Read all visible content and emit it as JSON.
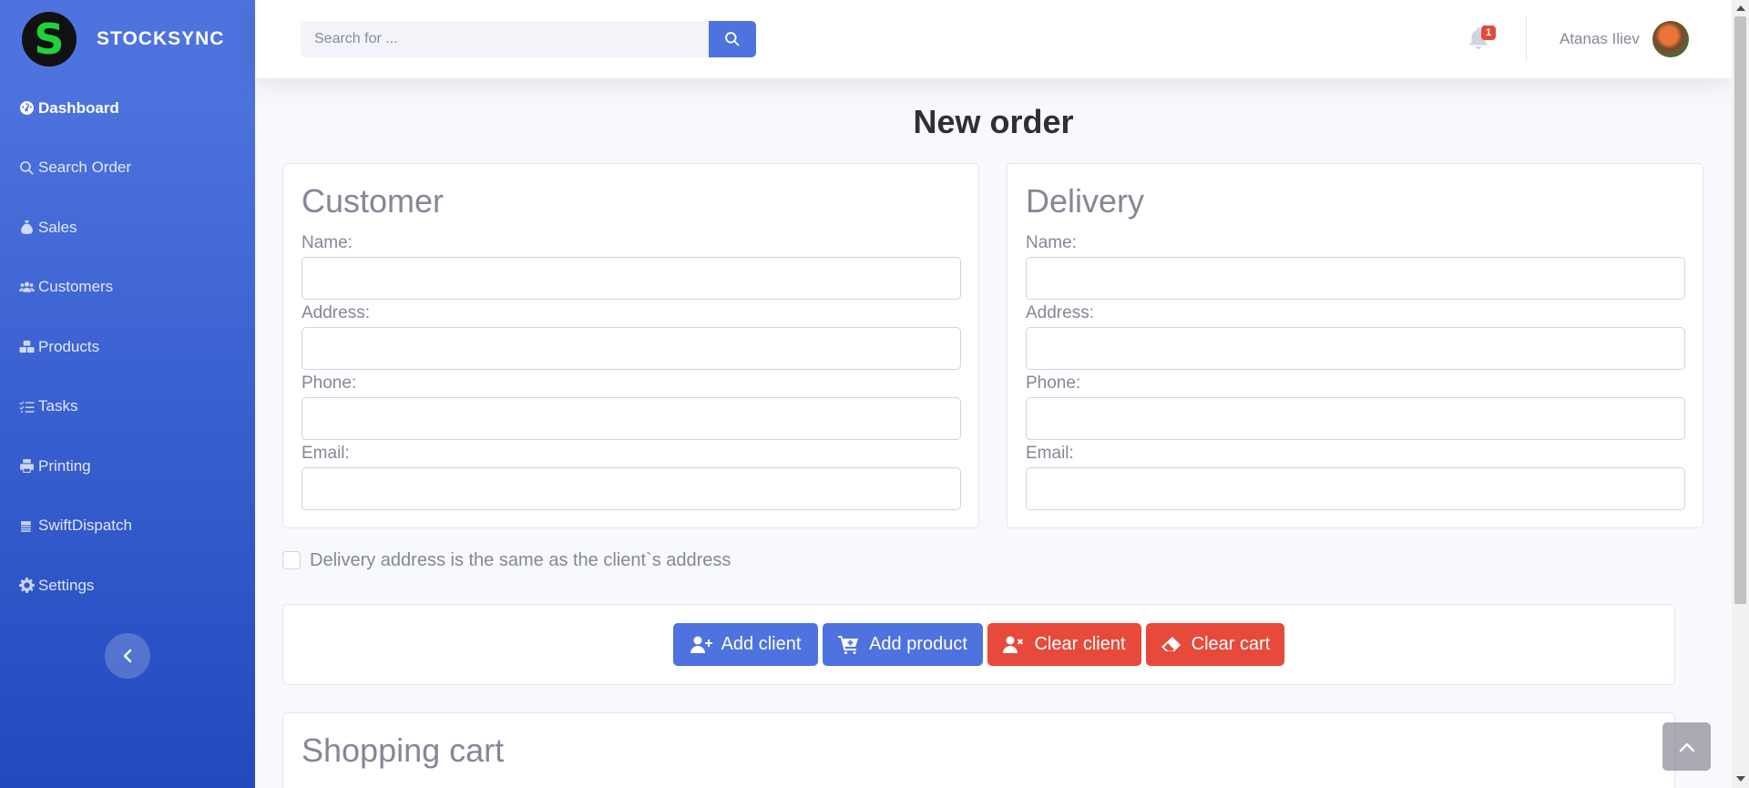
{
  "brand": {
    "logo_letter": "S",
    "name": "STOCKSYNC",
    "logo_color": "#1fd13b"
  },
  "sidebar": {
    "items": [
      {
        "label": "Dashboard",
        "icon": "dashboard-icon",
        "active": true
      },
      {
        "label": "Search Order",
        "icon": "search-icon"
      },
      {
        "label": "Sales",
        "icon": "money-bag-icon"
      },
      {
        "label": "Customers",
        "icon": "users-icon"
      },
      {
        "label": "Products",
        "icon": "boxes-icon"
      },
      {
        "label": "Tasks",
        "icon": "list-check-icon"
      },
      {
        "label": "Printing",
        "icon": "printer-icon"
      },
      {
        "label": "SwiftDispatch",
        "icon": "truck-icon"
      },
      {
        "label": "Settings",
        "icon": "gear-icon"
      }
    ],
    "toggle_icon": "chevron-left-icon"
  },
  "topbar": {
    "search_placeholder": "Search for ...",
    "notification_count": "1",
    "user_name": "Atanas Iliev"
  },
  "page": {
    "title": "New order"
  },
  "customer": {
    "heading": "Customer",
    "name_label": "Name:",
    "address_label": "Address:",
    "phone_label": "Phone:",
    "email_label": "Email:"
  },
  "delivery": {
    "heading": "Delivery",
    "name_label": "Name:",
    "address_label": "Address:",
    "phone_label": "Phone:",
    "email_label": "Email:"
  },
  "same_address_label": "Delivery address is the same as the client`s address",
  "actions": {
    "add_client": "Add client",
    "add_product": "Add product",
    "clear_client": "Clear client",
    "clear_cart": "Clear cart"
  },
  "cart": {
    "heading": "Shopping cart"
  },
  "colors": {
    "primary": "#4e73df",
    "danger": "#e74a3b"
  }
}
